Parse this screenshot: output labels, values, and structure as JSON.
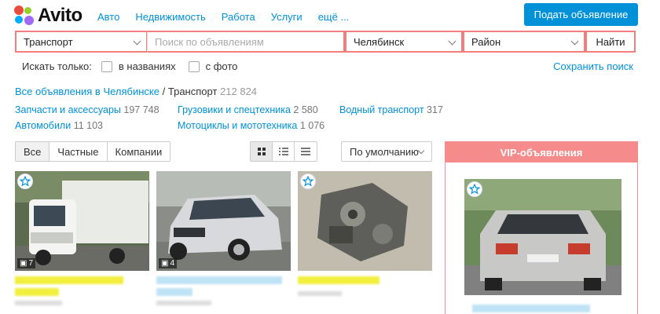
{
  "brand": {
    "name": "Avito"
  },
  "nav": [
    "Авто",
    "Недвижимость",
    "Работа",
    "Услуги",
    "ещё ..."
  ],
  "post_button": "Подать объявление",
  "search": {
    "category": "Транспорт",
    "query_placeholder": "Поиск по объявлениям",
    "city": "Челябинск",
    "region": "Район",
    "find_label": "Найти"
  },
  "filters": {
    "label": "Искать только:",
    "in_titles": "в названиях",
    "with_photo": "с фото",
    "save_search": "Сохранить поиск"
  },
  "breadcrumb": {
    "all": "Все объявления в Челябинске",
    "separator": "/",
    "current": "Транспорт",
    "count": "212 824"
  },
  "categories": [
    {
      "name": "Запчасти и аксессуары",
      "count": "197 748"
    },
    {
      "name": "Автомобили",
      "count": "11 103"
    },
    {
      "name": "Грузовики и спецтехника",
      "count": "2 580"
    },
    {
      "name": "Мотоциклы и мототехника",
      "count": "1 076"
    },
    {
      "name": "Водный транспорт",
      "count": "317"
    }
  ],
  "seller_filter": [
    "Все",
    "Частные",
    "Компании"
  ],
  "sort": "По умолчанию",
  "listings": [
    {
      "photos": "7"
    },
    {
      "photos": "4"
    },
    {
      "photos": ""
    }
  ],
  "vip": {
    "title": "VIP-объявления"
  },
  "colors": {
    "link": "#0091d9",
    "accent": "#f58b8b",
    "highlight": "#f5f542"
  }
}
